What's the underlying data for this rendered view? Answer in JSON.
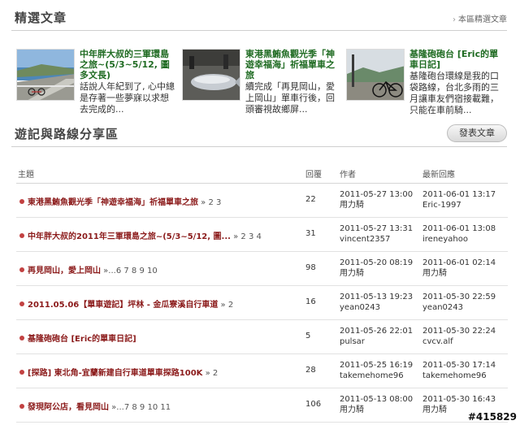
{
  "featured": {
    "title": "精選文章",
    "more_label": "本區精選文章",
    "items": [
      {
        "title": "中年胖大叔的三軍環島之旅~(5/3~5/12, 圖多文長)",
        "desc": "話說人年紀到了, 心中總是存著一些夢寐以求想去完成的..."
      },
      {
        "title": "東港黑鮪魚觀光季「神遊幸福海」祈福單車之旅",
        "desc": "續完成「再見岡山，愛上岡山」單車行後，回頭審視故鄉屏..."
      },
      {
        "title": "基隆砲砲台 [Eric的單車日記]",
        "desc": "基隆砲台環線是我的口袋路線，台北多雨的三月讓車友們宿接載難，只能在車前騎..."
      }
    ]
  },
  "forum": {
    "title": "遊記與路線分享區",
    "post_button": "發表文章",
    "columns": {
      "topic": "主題",
      "replies": "回覆",
      "author": "作者",
      "last": "最新回應"
    },
    "rows": [
      {
        "title": "東港黑鮪魚觀光季「神遊幸福海」祈福單車之旅",
        "pages": " » 2 3",
        "replies": "22",
        "author_time": "2011-05-27 13:00",
        "author": "用力騎",
        "last_time": "2011-06-01 13:17",
        "last_user": "Eric-1997"
      },
      {
        "title": "中年胖大叔的2011年三軍環島之旅~(5/3~5/12, 圖...",
        "pages": " » 2 3 4",
        "replies": "31",
        "author_time": "2011-05-27 13:31",
        "author": "vincent2357",
        "last_time": "2011-06-01 13:08",
        "last_user": "ireneyahoo"
      },
      {
        "title": "再見岡山，愛上岡山",
        "pages": " »...6 7 8 9 10",
        "replies": "98",
        "author_time": "2011-05-20 08:19",
        "author": "用力騎",
        "last_time": "2011-06-01 02:14",
        "last_user": "用力騎"
      },
      {
        "title": "2011.05.06【單車遊記】坪林 - 金瓜寮溪自行車道",
        "pages": " » 2",
        "replies": "16",
        "author_time": "2011-05-13 19:23",
        "author": "yean0243",
        "last_time": "2011-05-30 22:59",
        "last_user": "yean0243"
      },
      {
        "title": "基隆砲砲台 [Eric的單車日記]",
        "pages": "",
        "replies": "5",
        "author_time": "2011-05-26 22:01",
        "author": "pulsar",
        "last_time": "2011-05-30 22:24",
        "last_user": "cvcv.alf"
      },
      {
        "title": "[探路] 東北角-宜蘭新建自行車道單車探路100K",
        "pages": " » 2",
        "replies": "28",
        "author_time": "2011-05-25 16:19",
        "author": "takemehome96",
        "last_time": "2011-05-30 17:14",
        "last_user": "takemehome96"
      },
      {
        "title": "發現阿公店，看見岡山",
        "pages": " »...7 8 9 10 11",
        "replies": "106",
        "author_time": "2011-05-13 08:00",
        "author": "用力騎",
        "last_time": "2011-05-30 16:43",
        "last_user": "用力騎"
      }
    ]
  },
  "watermark": "#415829"
}
